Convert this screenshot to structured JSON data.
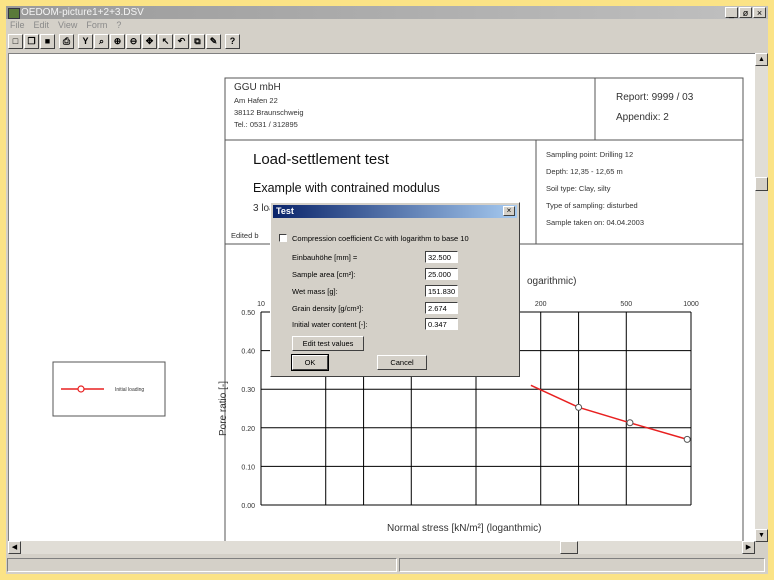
{
  "window": {
    "title": "OEDOM-picture1+2+3.DSV",
    "controls": [
      "_",
      "ø",
      "×"
    ]
  },
  "menu": [
    "File",
    "Edit",
    "View",
    "Form",
    "?"
  ],
  "toolbar": [
    {
      "name": "new-icon",
      "glyph": "□"
    },
    {
      "name": "open-icon",
      "glyph": "❐"
    },
    {
      "name": "save-icon",
      "glyph": "■"
    },
    {
      "name": "print-icon",
      "glyph": "⎙"
    },
    {
      "name": "filter-icon",
      "glyph": "Y"
    },
    {
      "name": "zoom-icon",
      "glyph": "⌕"
    },
    {
      "name": "zoom-in-icon",
      "glyph": "⊕"
    },
    {
      "name": "zoom-out-icon",
      "glyph": "⊖"
    },
    {
      "name": "move-icon",
      "glyph": "✥"
    },
    {
      "name": "pointer-icon",
      "glyph": "↖"
    },
    {
      "name": "undo-icon",
      "glyph": "↶"
    },
    {
      "name": "copy-icon",
      "glyph": "⧉"
    },
    {
      "name": "edit-icon",
      "glyph": "✎"
    },
    {
      "name": "help-icon",
      "glyph": "?"
    }
  ],
  "company": {
    "name": "GGU mbH",
    "street": "Am Hafen 22",
    "city": "38112 Braunschweig",
    "phone": "Tel.: 0531 / 312895"
  },
  "report": {
    "number": "Report: 9999 / 03",
    "appendix": "Appendix: 2"
  },
  "heading": {
    "title": "Load-settlement test",
    "subtitle": "Example with contrained modulus",
    "stages": "3 load stages",
    "edited_by": "Edited b"
  },
  "sample_info": {
    "point": "Sampling point:  Drilling 12",
    "depth": "Depth:  12,35 - 12,65 m",
    "soil": "Soil type:  Clay, silty",
    "type": "Type of sampling:  disturbed",
    "date": "Sample taken on:  04.04.2003"
  },
  "legend": {
    "label": "Initial loading"
  },
  "chart_data": {
    "type": "line",
    "xlabel": "Normal stress [kN/m²]  (loganthmic)",
    "ylabel": "Pore ratio [-]",
    "x_scale": "log",
    "x_top_title_fragment": "ogarithmic)",
    "xlim": [
      10,
      1000
    ],
    "ylim": [
      0.0,
      0.5
    ],
    "x_ticks": [
      "10",
      "200",
      "500",
      "1000"
    ],
    "y_ticks": [
      "0.00",
      "0.10",
      "0.20",
      "0.30",
      "0.40",
      "0.50"
    ],
    "grid": true,
    "legend_position": "left",
    "series": [
      {
        "name": "Initial loading",
        "color": "#e82020",
        "x": [
          180,
          300,
          520,
          960
        ],
        "y": [
          0.31,
          0.253,
          0.213,
          0.17
        ]
      }
    ]
  },
  "dialog": {
    "title": "Test",
    "checkbox_label": "Compression coefficient Cc with logarithm to base 10",
    "fields": [
      {
        "label": "Einbauhöhe [mm] =",
        "value": "32.500"
      },
      {
        "label": "Sample area [cm²]:",
        "value": "25.000"
      },
      {
        "label": "Wet mass [g]:",
        "value": "151.830"
      },
      {
        "label": "Grain density [g/cm³]:",
        "value": "2.674"
      },
      {
        "label": "Initial water content [-]:",
        "value": "0.347"
      }
    ],
    "edit_button": "Edit test values",
    "ok_button": "OK",
    "cancel_button": "Cancel"
  }
}
